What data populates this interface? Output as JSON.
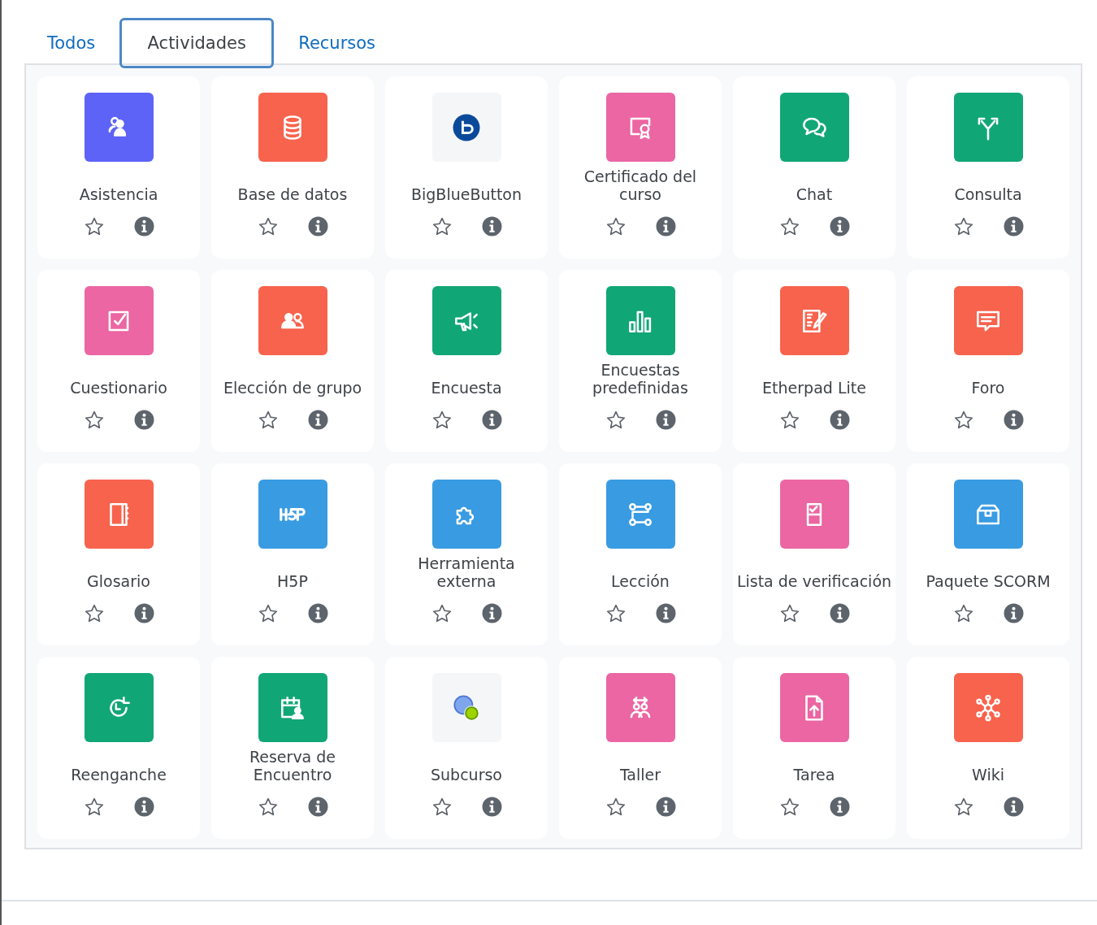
{
  "tabs": [
    {
      "label": "Todos",
      "selected": false
    },
    {
      "label": "Actividades",
      "selected": true
    },
    {
      "label": "Recursos",
      "selected": false
    }
  ],
  "modules": [
    {
      "name": "Asistencia",
      "color": "#5d63f6",
      "starred": false
    },
    {
      "name": "Base de datos",
      "color": "#f7634d",
      "starred": false
    },
    {
      "name": "BigBlueButton",
      "color": "#f5f6f8",
      "starred": false
    },
    {
      "name": "Certificado del curso",
      "color": "#eb66a2",
      "starred": false
    },
    {
      "name": "Chat",
      "color": "#11a676",
      "starred": false
    },
    {
      "name": "Consulta",
      "color": "#11a676",
      "starred": false
    },
    {
      "name": "Cuestionario",
      "color": "#eb66a2",
      "starred": false
    },
    {
      "name": "Elección de grupo",
      "color": "#f7634d",
      "starred": false
    },
    {
      "name": "Encuesta",
      "color": "#11a676",
      "starred": false
    },
    {
      "name": "Encuestas predefinidas",
      "color": "#11a676",
      "starred": false
    },
    {
      "name": "Etherpad Lite",
      "color": "#f7634d",
      "starred": false
    },
    {
      "name": "Foro",
      "color": "#f7634d",
      "starred": false
    },
    {
      "name": "Glosario",
      "color": "#f7634d",
      "starred": false
    },
    {
      "name": "H5P",
      "color": "#399be2",
      "starred": false
    },
    {
      "name": "Herramienta externa",
      "color": "#399be2",
      "starred": false
    },
    {
      "name": "Lección",
      "color": "#399be2",
      "starred": false
    },
    {
      "name": "Lista de verificación",
      "color": "#eb66a2",
      "starred": false
    },
    {
      "name": "Paquete SCORM",
      "color": "#399be2",
      "starred": false
    },
    {
      "name": "Reenganche",
      "color": "#11a676",
      "starred": false
    },
    {
      "name": "Reserva de Encuentro",
      "color": "#11a676",
      "starred": false
    },
    {
      "name": "Subcurso",
      "color": "#f5f6f8",
      "starred": false
    },
    {
      "name": "Taller",
      "color": "#eb66a2",
      "starred": false
    },
    {
      "name": "Tarea",
      "color": "#eb66a2",
      "starred": false
    },
    {
      "name": "Wiki",
      "color": "#f7634d",
      "starred": false
    }
  ]
}
